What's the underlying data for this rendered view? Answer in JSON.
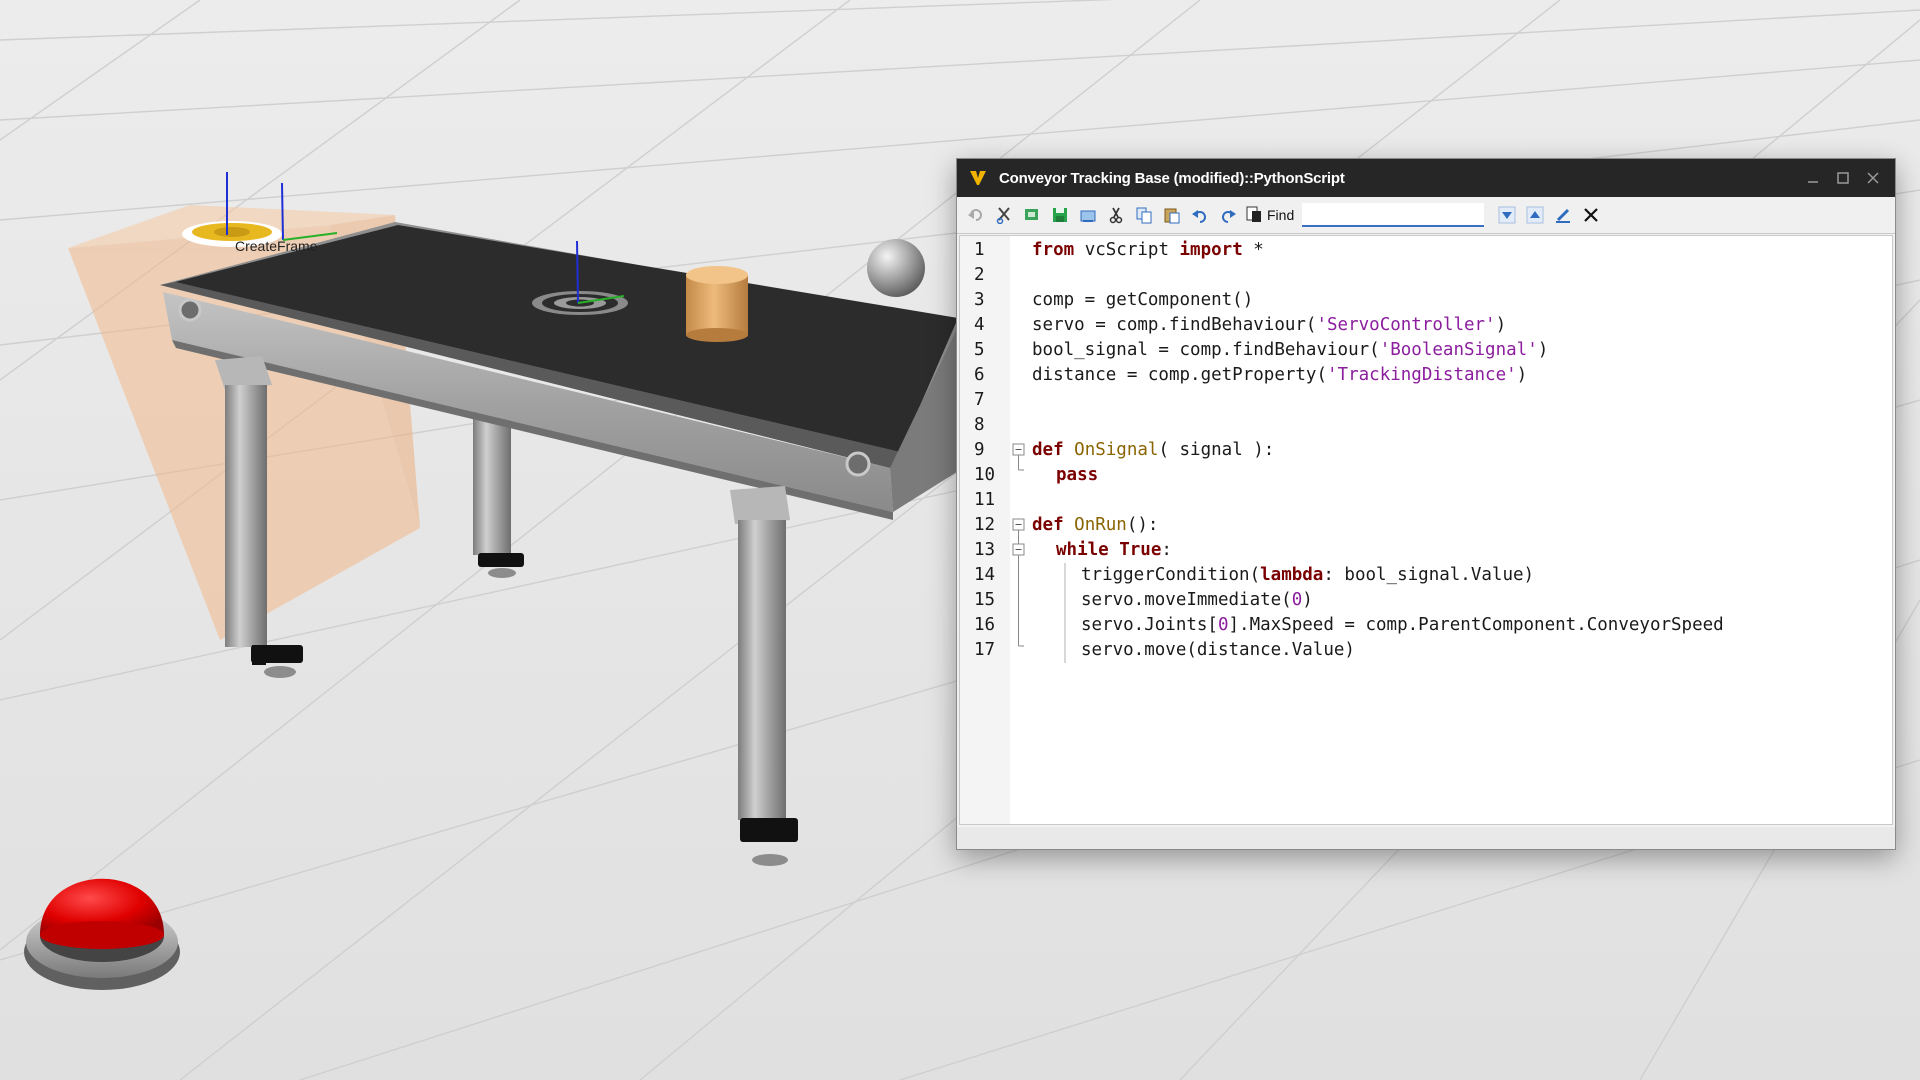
{
  "scene": {
    "frame_label": "CreateFrame",
    "colors": {
      "floor": "#e7e7e7",
      "belt": "#2c2c2c",
      "frame_metal": "#a8a8a8",
      "cylinder": "#d8a463",
      "button_red": "#e00000",
      "volume_tint": "#f2b98a"
    }
  },
  "editor": {
    "title": "Conveyor Tracking Base (modified)::PythonScript",
    "find": {
      "label": "Find",
      "value": ""
    },
    "toolbar_icons": [
      "undo-disabled-icon",
      "cut-script-icon",
      "compile-icon",
      "save-icon",
      "export-icon",
      "cut-icon",
      "copy-icon",
      "paste-icon",
      "undo-icon",
      "redo-icon",
      "find-page-icon",
      "find-next-icon",
      "find-previous-icon",
      "highlight-icon",
      "clear-find-icon"
    ],
    "code_lines": [
      "1",
      "2",
      "3",
      "4",
      "5",
      "6",
      "7",
      "8",
      "9",
      "10",
      "11",
      "12",
      "13",
      "14",
      "15",
      "16",
      "17"
    ],
    "code": {
      "l1": [
        "from",
        " vcScript ",
        "import",
        " *"
      ],
      "l3": [
        "comp = getComponent()"
      ],
      "l4": [
        "servo = comp.findBehaviour(",
        "'ServoController'",
        ")"
      ],
      "l5": [
        "bool_signal = comp.findBehaviour(",
        "'BooleanSignal'",
        ")"
      ],
      "l6": [
        "distance = comp.getProperty(",
        "'TrackingDistance'",
        ")"
      ],
      "l9": [
        "def",
        " ",
        "OnSignal",
        "( signal ):"
      ],
      "l10": [
        "pass"
      ],
      "l12": [
        "def",
        " ",
        "OnRun",
        "():"
      ],
      "l13": [
        "while",
        " ",
        "True",
        ":"
      ],
      "l14": [
        "triggerCondition(",
        "lambda",
        ": bool_signal.Value)"
      ],
      "l15": [
        "servo.moveImmediate(",
        "0",
        ")"
      ],
      "l16": [
        "servo.Joints[",
        "0",
        "].MaxSpeed = comp.ParentComponent.ConveyorSpeed"
      ],
      "l17": [
        "servo.move(distance.Value)"
      ]
    },
    "colors": {
      "keyword": "#7a0000",
      "function": "#8a6400",
      "string": "#8b1d9e",
      "titlebar": "#262626"
    }
  }
}
